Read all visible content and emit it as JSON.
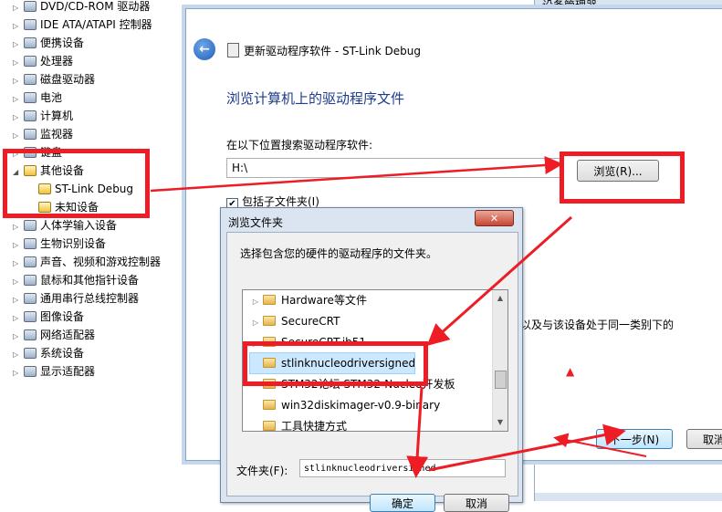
{
  "device_tree": {
    "items": [
      {
        "label": "DVD/CD-ROM 驱动器",
        "expander": "▷",
        "icon": "dvd-icon"
      },
      {
        "label": "IDE ATA/ATAPI 控制器",
        "expander": "▷",
        "icon": "ide-controller-icon"
      },
      {
        "label": "便携设备",
        "expander": "▷",
        "icon": "portable-device-icon"
      },
      {
        "label": "处理器",
        "expander": "▷",
        "icon": "processor-icon"
      },
      {
        "label": "磁盘驱动器",
        "expander": "▷",
        "icon": "disk-icon"
      },
      {
        "label": "电池",
        "expander": "▷",
        "icon": "battery-icon"
      },
      {
        "label": "计算机",
        "expander": "▷",
        "icon": "computer-icon"
      },
      {
        "label": "监视器",
        "expander": "▷",
        "icon": "monitor-icon"
      },
      {
        "label": "键盘",
        "expander": "▷",
        "icon": "keyboard-icon"
      },
      {
        "label": "其他设备",
        "expander": "◢",
        "icon": "other-devices-icon"
      },
      {
        "label": "ST-Link Debug",
        "expander": "",
        "icon": "warning-device-icon"
      },
      {
        "label": "未知设备",
        "expander": "",
        "icon": "warning-device-icon"
      },
      {
        "label": "人体学输入设备",
        "expander": "▷",
        "icon": "hid-icon"
      },
      {
        "label": "生物识别设备",
        "expander": "▷",
        "icon": "biometric-icon"
      },
      {
        "label": "声音、视频和游戏控制器",
        "expander": "▷",
        "icon": "sound-icon"
      },
      {
        "label": "鼠标和其他指针设备",
        "expander": "▷",
        "icon": "mouse-icon"
      },
      {
        "label": "通用串行总线控制器",
        "expander": "▷",
        "icon": "usb-icon"
      },
      {
        "label": "图像设备",
        "expander": "▷",
        "icon": "camera-icon"
      },
      {
        "label": "网络适配器",
        "expander": "▷",
        "icon": "network-icon"
      },
      {
        "label": "系统设备",
        "expander": "▷",
        "icon": "system-icon"
      },
      {
        "label": "显示适配器",
        "expander": "▷",
        "icon": "display-adapter-icon"
      }
    ]
  },
  "device_manager_strip": {
    "title": "设备管理器"
  },
  "wizard": {
    "title": "更新驱动程序软件 - ST-Link Debug",
    "heading": "浏览计算机上的驱动程序文件",
    "search_label": "在以下位置搜索驱动程序软件:",
    "path_value": "H:\\",
    "browse_label": "浏览(R)...",
    "include_subfolders": "包括子文件夹(I)",
    "include_checked": "✔",
    "partial_text": "以及与该设备处于同一类别下的",
    "next_label": "下一步(N)",
    "cancel_label": "取消"
  },
  "browse_dialog": {
    "title": "浏览文件夹",
    "close_glyph": "✕",
    "description": "选择包含您的硬件的驱动程序的文件夹。",
    "folders": [
      {
        "label": "Hardware等文件",
        "expander": "▷",
        "selected": false
      },
      {
        "label": "SecureCRT",
        "expander": "▷",
        "selected": false
      },
      {
        "label": "SecureCRT.ib51",
        "expander": "▷",
        "selected": false
      },
      {
        "label": "stlinknucleodriversigned",
        "expander": "",
        "selected": true
      },
      {
        "label": "STM32论坛 STM32-Nucleo开发板",
        "expander": "",
        "selected": false
      },
      {
        "label": "win32diskimager-v0.9-binary",
        "expander": "",
        "selected": false
      },
      {
        "label": "工具快捷方式",
        "expander": "",
        "selected": false
      }
    ],
    "folder_label": "文件夹(F):",
    "folder_value": "stlinknucleodriversigned",
    "ok_label": "确定",
    "cancel_label": "取消",
    "scroll_up": "▲",
    "scroll_down": "▼"
  },
  "annotation": {
    "color": "#ee1c24",
    "marker": "▲"
  }
}
